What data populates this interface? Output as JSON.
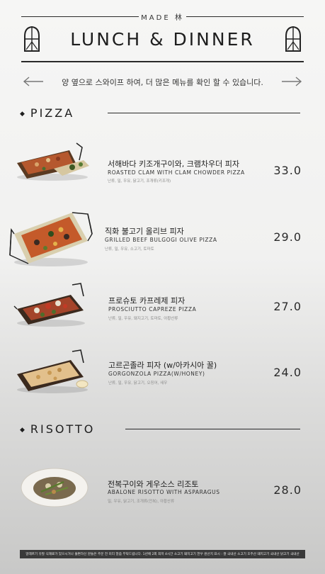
{
  "header": {
    "brand": "MADE 林",
    "title": "LUNCH & DINNER",
    "swipe_hint": "양 옆으로 스와이프 하여, 더 많은 메뉴를 확인 할 수 있습니다."
  },
  "icons": {
    "left_arrow": "left-arrow-icon",
    "right_arrow": "right-arrow-icon",
    "window": "arched-window-icon"
  },
  "colors": {
    "text": "#1e1e1e",
    "line": "#2a2a2a",
    "footer_bg": "#3a3a3a"
  },
  "sections": {
    "pizza": {
      "title": "PIZZA",
      "items": [
        {
          "name_ko": "서해바다 키조개구이와, 크램차우더 피자",
          "name_en": "ROASTED CLAM WITH CLAM CHOWDER PIZZA",
          "allergens": "난류, 밀, 우유, 닭고기, 조개류(키조개)",
          "price": "33.0"
        },
        {
          "name_ko": "직화 불고기 올리브 피자",
          "name_en": "GRILLED BEEF BULGOGI OLIVE PIZZA",
          "allergens": "난류, 밀, 우유, 소고기, 토마토",
          "price": "29.0"
        },
        {
          "name_ko": "프로슈토 카프레제 피자",
          "name_en": "PROSCIUTTO CAPREZE PIZZA",
          "allergens": "난류, 밀, 우유, 돼지고기, 토마토, 아황산류",
          "price": "27.0"
        },
        {
          "name_ko": "고르곤졸라 피자 (w/아카시아 꿀)",
          "name_en": "GORGONZOLA PIZZA(W/HONEY)",
          "allergens": "난류, 밀, 우유, 닭고기, 오징어, 새우",
          "price": "24.0"
        }
      ]
    },
    "risotto": {
      "title": "RISOTTO",
      "items": [
        {
          "name_ko": "전복구이와 게우소스 리조토",
          "name_en": "ABALONE RISOTTO WITH ASPARAGUS",
          "allergens": "밀, 우유, 닭고기, 조개류(전복), 아황산류",
          "price": "28.0"
        }
      ]
    }
  },
  "footer": {
    "notice": "알레르기 유발 식재료가 있으시거나 불편하신 분들은 주문 전 미리 말씀 부탁드립니다. 1년에 2회 최저 4시간 소고기 돼지고기 한우 원산지 표시 : 쌀 국내산 소고기 호주산 돼지고기 국내산 닭고기 국내산"
  }
}
